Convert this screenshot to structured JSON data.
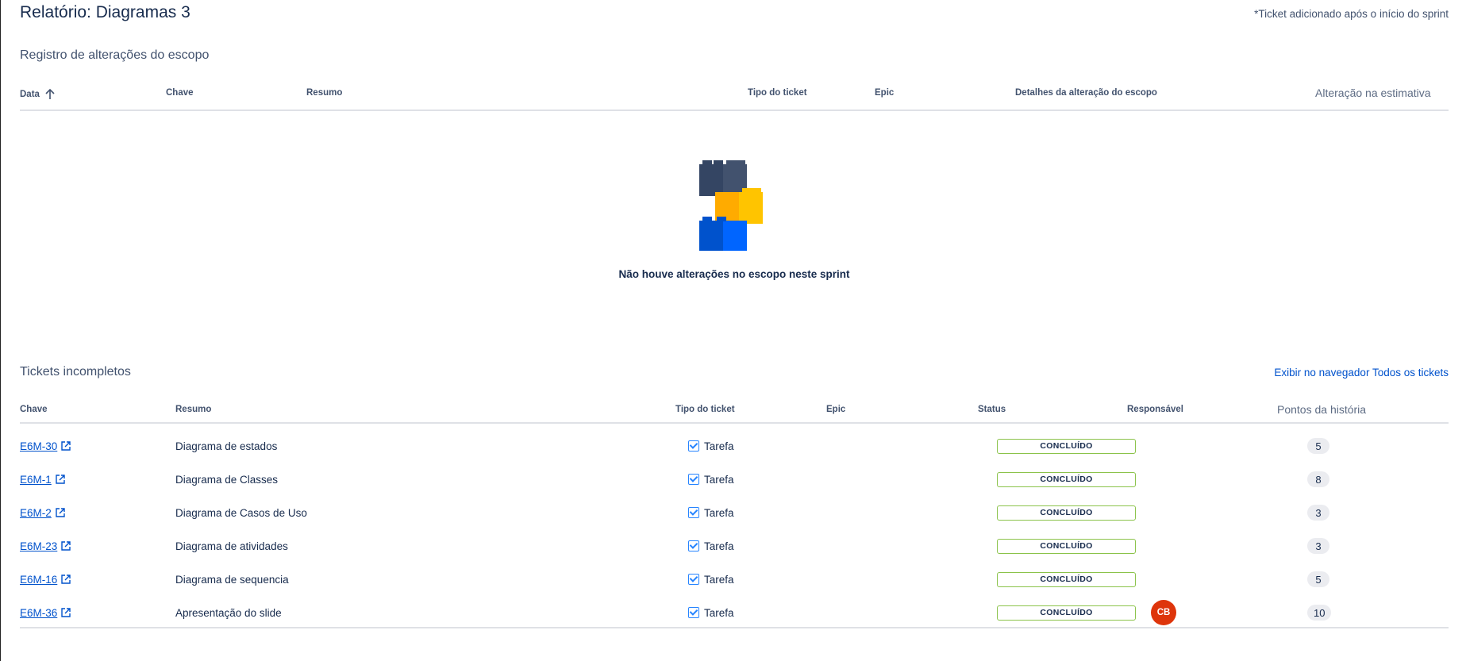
{
  "report": {
    "title": "Relatório: Diagramas 3",
    "sprint_note": "*Ticket adicionado após o início do sprint"
  },
  "scope_changes": {
    "title": "Registro de alterações do escopo",
    "columns": {
      "data": "Data",
      "chave": "Chave",
      "resumo": "Resumo",
      "tipo": "Tipo do ticket",
      "epic": "Epic",
      "detalhes": "Detalhes da alteração do escopo",
      "alteracao": "Alteração na estimativa"
    },
    "sort_icon": "arrow-up-icon",
    "empty_icon": "lego-bricks-illustration",
    "empty_message": "Não houve alterações no escopo neste sprint"
  },
  "incomplete": {
    "title": "Tickets incompletos",
    "view_link": "Exibir no navegador Todos os tickets",
    "columns": {
      "chave": "Chave",
      "resumo": "Resumo",
      "tipo": "Tipo do ticket",
      "epic": "Epic",
      "status": "Status",
      "responsavel": "Responsável",
      "pontos": "Pontos da história"
    },
    "rows": [
      {
        "key": "E6M-30",
        "summary": "Diagrama de estados",
        "type": "Tarefa",
        "epic": "",
        "status": "CONCLUÍDO",
        "assignee": "",
        "points": "5"
      },
      {
        "key": "E6M-1",
        "summary": "Diagrama de Classes",
        "type": "Tarefa",
        "epic": "",
        "status": "CONCLUÍDO",
        "assignee": "",
        "points": "8"
      },
      {
        "key": "E6M-2",
        "summary": "Diagrama de Casos de Uso",
        "type": "Tarefa",
        "epic": "",
        "status": "CONCLUÍDO",
        "assignee": "",
        "points": "3"
      },
      {
        "key": "E6M-23",
        "summary": "Diagrama de atividades",
        "type": "Tarefa",
        "epic": "",
        "status": "CONCLUÍDO",
        "assignee": "",
        "points": "3"
      },
      {
        "key": "E6M-16",
        "summary": "Diagrama de sequencia",
        "type": "Tarefa",
        "epic": "",
        "status": "CONCLUÍDO",
        "assignee": "",
        "points": "5"
      },
      {
        "key": "E6M-36",
        "summary": "Apresentação do slide",
        "type": "Tarefa",
        "epic": "",
        "status": "CONCLUÍDO",
        "assignee": "CB",
        "points": "10"
      }
    ]
  },
  "colors": {
    "link": "#0052cc",
    "status_border": "#8bc34a",
    "avatar": "#de350b",
    "text": "#172b4d"
  }
}
